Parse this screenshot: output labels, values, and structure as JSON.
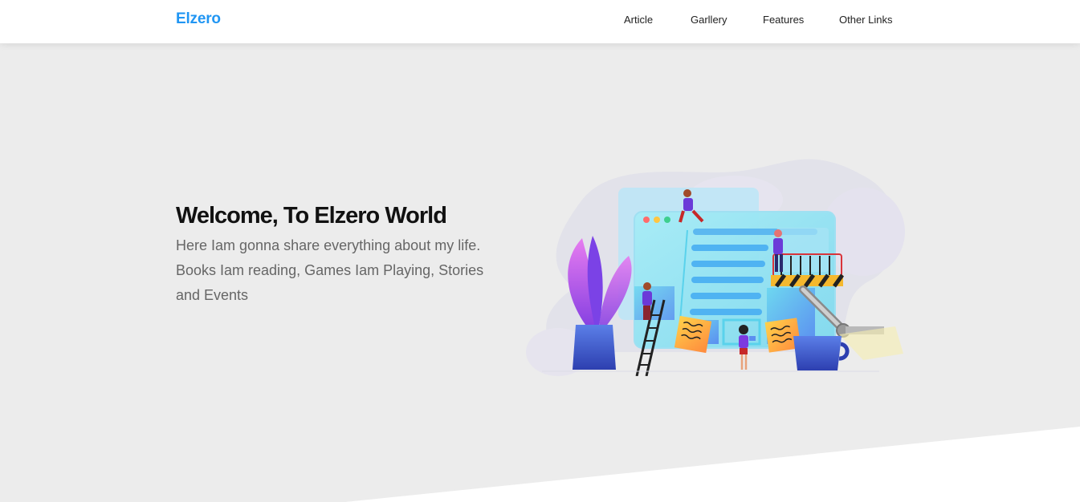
{
  "header": {
    "logo": "Elzero",
    "nav": [
      "Article",
      "Garllery",
      "Features",
      "Other Links"
    ]
  },
  "hero": {
    "title": "Welcome, To Elzero World",
    "intro": "Here Iam gonna share everything about my life. Books Iam reading, Games Iam Playing, Stories and Events"
  },
  "colors": {
    "brand": "#2196f3",
    "landing_bg": "#ececec",
    "title": "#111111",
    "intro": "#666666"
  }
}
